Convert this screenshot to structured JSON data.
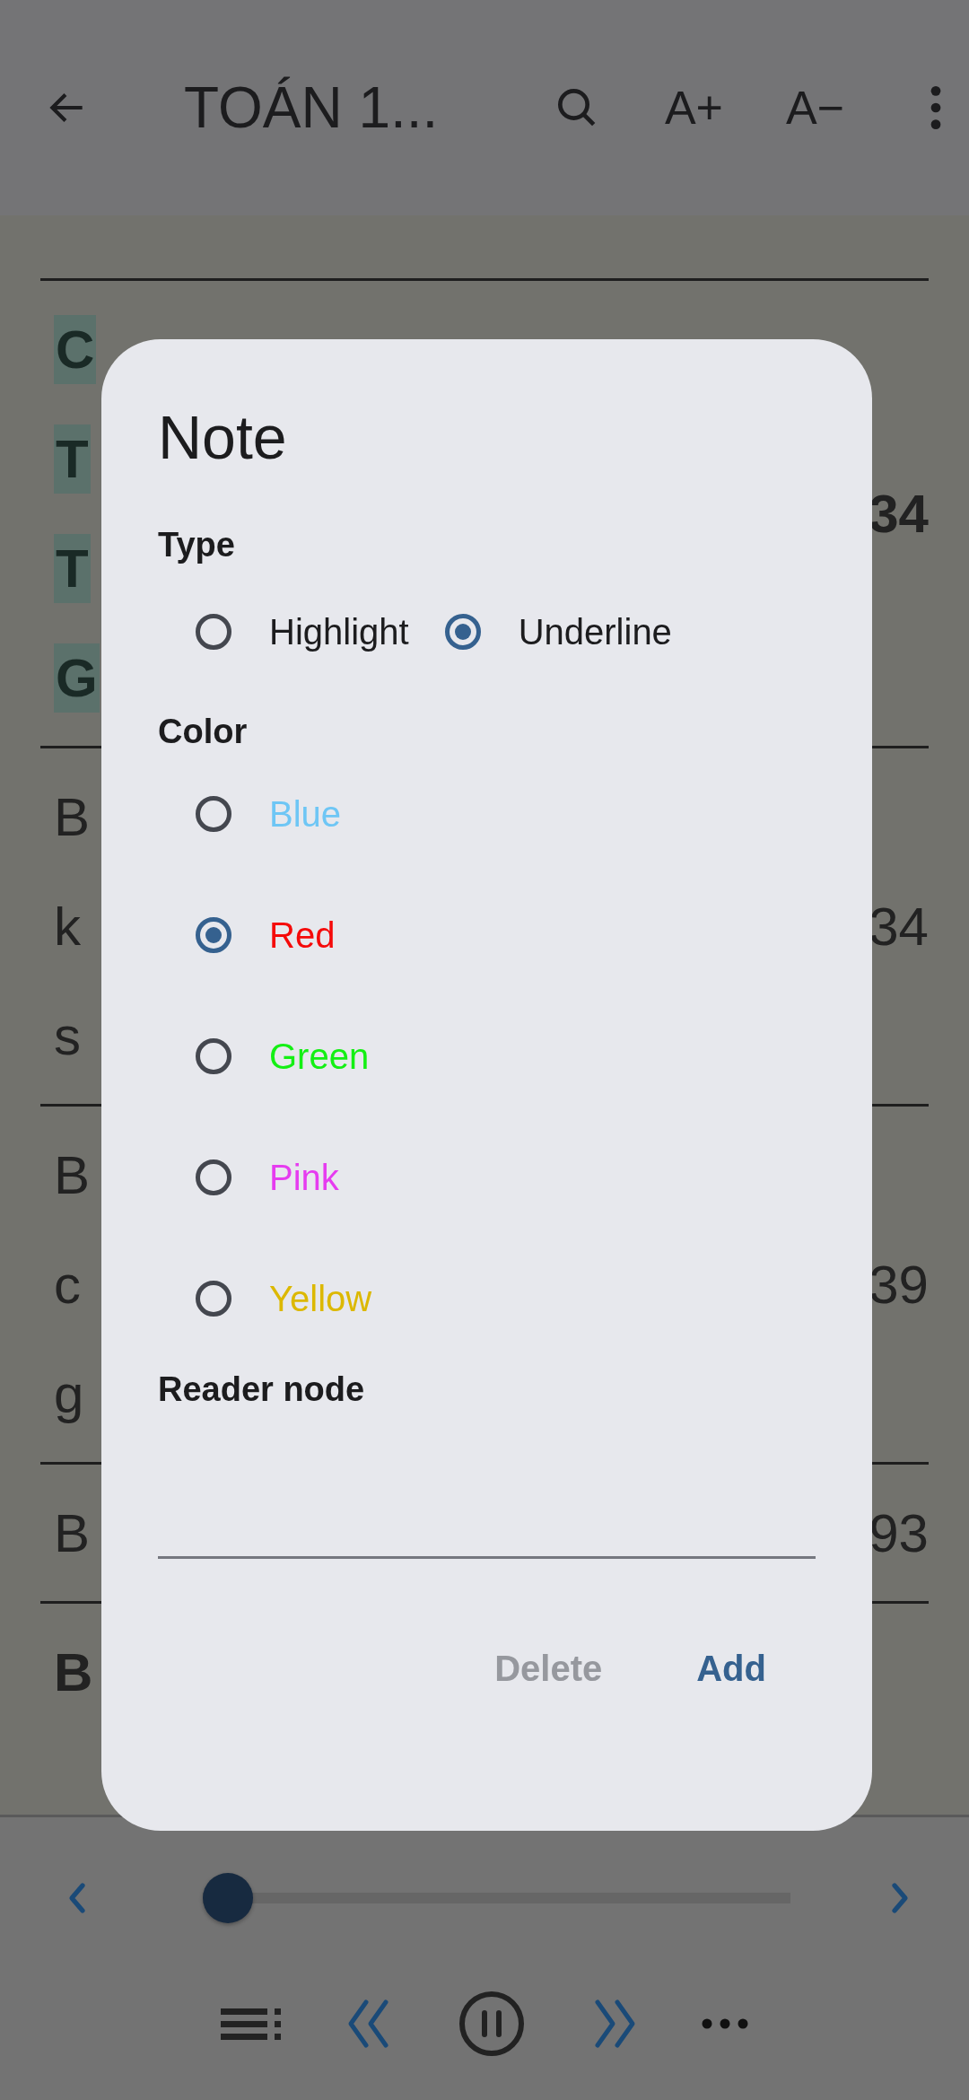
{
  "top_bar": {
    "title": "TOÁN 1...",
    "font_up": "A+",
    "font_down": "A−"
  },
  "content": {
    "heading_lines": [
      "C",
      "T",
      "T",
      "G"
    ],
    "heading_page": "34",
    "entries": [
      {
        "lines": [
          "B",
          "k",
          "s"
        ],
        "page": "34",
        "bold": false
      },
      {
        "lines": [
          "B",
          "c",
          "g"
        ],
        "page": "39",
        "bold": false
      },
      {
        "lines": [
          "B"
        ],
        "page": "93",
        "bold": false
      },
      {
        "lines": [
          "B"
        ],
        "bold": true
      }
    ]
  },
  "dialog": {
    "title": "Note",
    "type_label": "Type",
    "types": [
      {
        "label": "Highlight",
        "selected": false
      },
      {
        "label": "Underline",
        "selected": true
      }
    ],
    "color_label": "Color",
    "colors": [
      {
        "label": "Blue",
        "color": "#6ec6f5",
        "selected": false
      },
      {
        "label": "Red",
        "color": "#f50a0a",
        "selected": true
      },
      {
        "label": "Green",
        "color": "#14f014",
        "selected": false
      },
      {
        "label": "Pink",
        "color": "#e63cf0",
        "selected": false
      },
      {
        "label": "Yellow",
        "color": "#dcb800",
        "selected": false
      }
    ],
    "note_label": "Reader node",
    "buttons": [
      {
        "label": "Delete",
        "disabled": true
      },
      {
        "label": "Add",
        "disabled": false
      }
    ]
  },
  "player": {
    "level": 0
  }
}
